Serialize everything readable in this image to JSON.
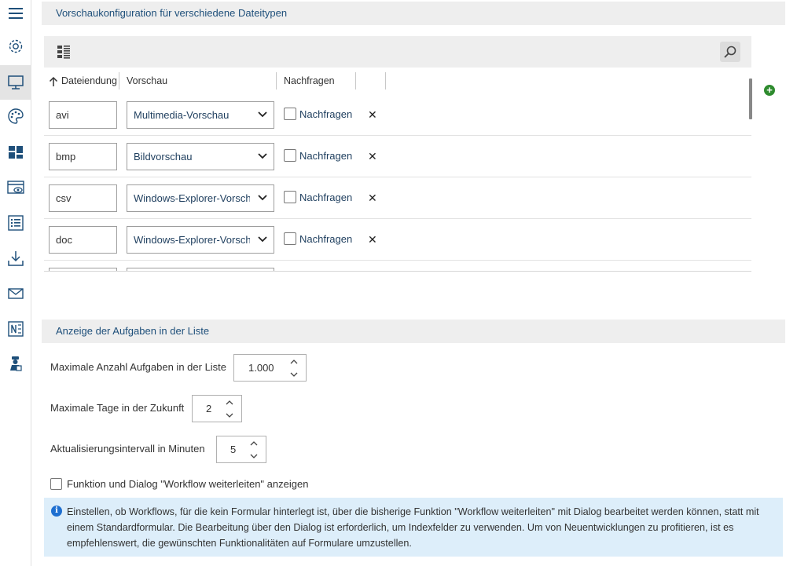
{
  "sidebar": {
    "items": [
      {
        "name": "menu-icon"
      },
      {
        "name": "gear-icon"
      },
      {
        "name": "monitor-icon",
        "active": true
      },
      {
        "name": "palette-icon"
      },
      {
        "name": "dashboard-icon"
      },
      {
        "name": "preview-window-icon"
      },
      {
        "name": "list-icon"
      },
      {
        "name": "download-icon"
      },
      {
        "name": "mail-icon"
      },
      {
        "name": "onenote-icon"
      },
      {
        "name": "agent-icon"
      }
    ]
  },
  "preview_section": {
    "title": "Vorschaukonfiguration für verschiedene Dateitypen",
    "table": {
      "columns": [
        "Dateiendung",
        "Vorschau",
        "Nachfragen"
      ],
      "rows": [
        {
          "extension": "avi",
          "preview": "Multimedia-Vorschau",
          "ask_label": "Nachfragen",
          "checked": false
        },
        {
          "extension": "bmp",
          "preview": "Bildvorschau",
          "ask_label": "Nachfragen",
          "checked": false
        },
        {
          "extension": "csv",
          "preview": "Windows-Explorer-Vorschau",
          "ask_label": "Nachfragen",
          "checked": false
        },
        {
          "extension": "doc",
          "preview": "Windows-Explorer-Vorschau",
          "ask_label": "Nachfragen",
          "checked": false
        }
      ]
    }
  },
  "tasks_section": {
    "title": "Anzeige der Aufgaben in der Liste",
    "fields": {
      "max_tasks": {
        "label": "Maximale Anzahl Aufgaben in der Liste",
        "value": "1.000"
      },
      "max_days": {
        "label": "Maximale Tage in der Zukunft",
        "value": "2"
      },
      "refresh": {
        "label": "Aktualisierungsintervall in Minuten",
        "value": "5"
      }
    },
    "forward_checkbox": {
      "label": "Funktion und Dialog \"Workflow weiterleiten\" anzeigen",
      "checked": false
    },
    "info_text": "Einstellen, ob Workflows, für die kein Formular hinterlegt ist, über die bisherige Funktion \"Workflow weiterleiten\" mit Dialog bearbeitet werden können, statt mit einem Standardformular. Die Bearbeitung über den Dialog ist erforderlich, um Indexfelder zu verwenden. Um von Neuentwicklungen zu profitieren, ist es empfehlenswert, die gewünschten Funktionalitäten auf Formulare umzustellen."
  },
  "colors": {
    "accent": "#1e4f7a",
    "info_bg": "#ddeefa",
    "add_green": "#2e8b2e"
  }
}
